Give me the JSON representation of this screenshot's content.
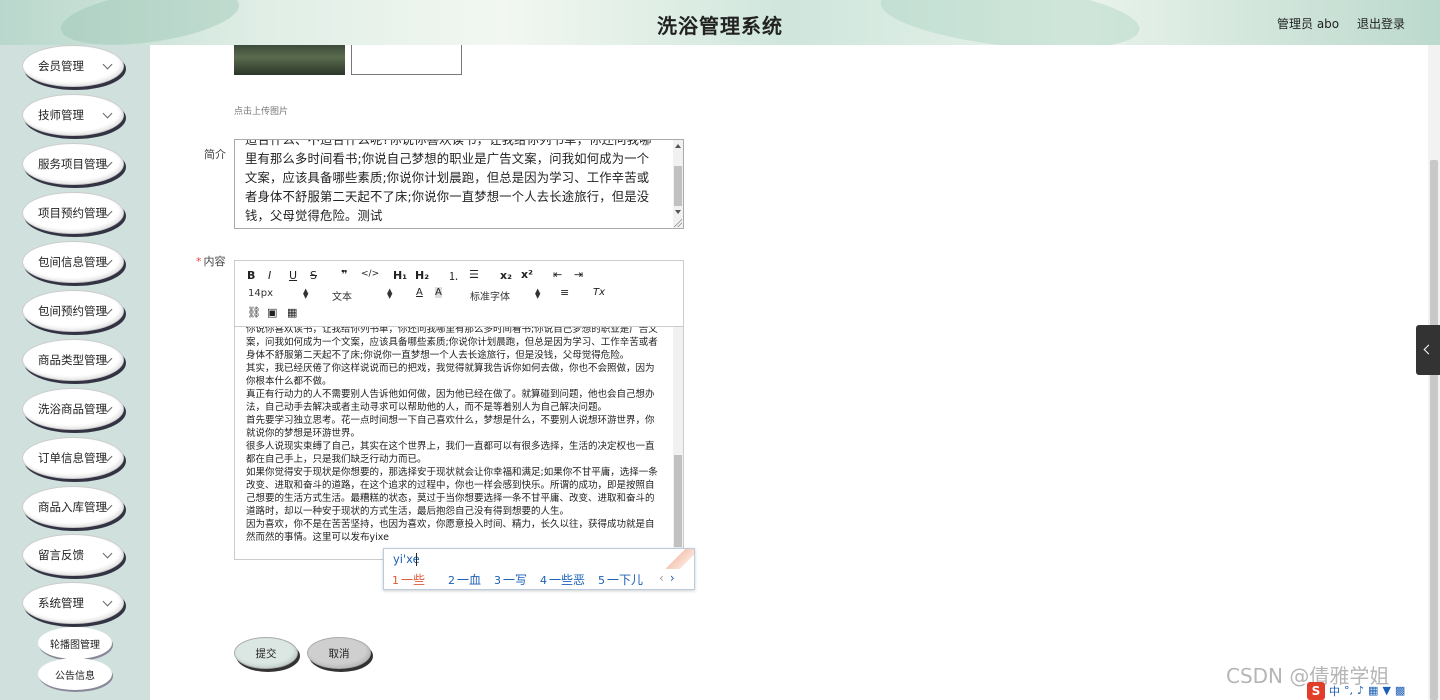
{
  "header": {
    "title": "洗浴管理系统",
    "user": "管理员 abo",
    "logout": "退出登录"
  },
  "sidebar": {
    "items": [
      {
        "label": "会员管理"
      },
      {
        "label": "技师管理"
      },
      {
        "label": "服务项目管理"
      },
      {
        "label": "项目预约管理"
      },
      {
        "label": "包间信息管理"
      },
      {
        "label": "包间预约管理"
      },
      {
        "label": "商品类型管理"
      },
      {
        "label": "洗浴商品管理"
      },
      {
        "label": "订单信息管理"
      },
      {
        "label": "商品入库管理"
      },
      {
        "label": "留言反馈"
      },
      {
        "label": "系统管理"
      }
    ],
    "sub_items": [
      {
        "label": "轮播图管理"
      },
      {
        "label": "公告信息"
      }
    ]
  },
  "form": {
    "upload_hint": "点击上传图片",
    "intro_label": "简介",
    "intro_text": "适合什么、不适合什么呢?你说你喜欢读书，让我给你列书单，你还问我哪里有那么多时间看书;你说自己梦想的职业是广告文案，问我如何成为一个文案，应该具备哪些素质;你说你计划晨跑，但总是因为学习、工作辛苦或者身体不舒服第二天起不了床;你说你一直梦想一个人去长途旅行，但是没钱，父母觉得危险。测试",
    "content_required": "*",
    "content_label": "内容",
    "content_paragraphs": [
      "你说你喜欢读书，让我给你列书单，你还问我哪里有那么多时间看书;你说自己梦想的职业是广告文案，问我如何成为一个文案，应该具备哪些素质;你说你计划晨跑，但总是因为学习、工作辛苦或者身体不舒服第二天起不了床;你说你一直梦想一个人去长途旅行，但是没钱，父母觉得危险。",
      "其实，我已经厌倦了你这样说说而已的把戏，我觉得就算我告诉你如何去做，你也不会照做，因为你根本什么都不做。",
      "真正有行动力的人不需要别人告诉他如何做，因为他已经在做了。就算碰到问题，他也会自己想办法，自己动手去解决或者主动寻求可以帮助他的人，而不是等着别人为自己解决问题。",
      "首先要学习独立思考。花一点时间想一下自己喜欢什么，梦想是什么，不要别人说想环游世界，你就说你的梦想是环游世界。",
      "很多人说现实束缚了自己，其实在这个世界上，我们一直都可以有很多选择，生活的决定权也一直都在自己手上，只是我们缺乏行动力而已。",
      "如果你觉得安于现状是你想要的，那选择安于现状就会让你幸福和满足;如果你不甘平庸，选择一条改变、进取和奋斗的道路，在这个追求的过程中，你也一样会感到快乐。所谓的成功，即是按照自己想要的生活方式生活。最糟糕的状态，莫过于当你想要选择一条不甘平庸、改变、进取和奋斗的道路时，却以一种安于现状的方式生活，最后抱怨自己没有得到想要的人生。",
      "因为喜欢，你不是在苦苦坚持，也因为喜欢，你愿意投入时间、精力，长久以往，获得成功就是自然而然的事情。这里可以发布yixe"
    ],
    "submit": "提交",
    "cancel": "取消"
  },
  "toolbar": {
    "bold": "B",
    "italic": "I",
    "underline": "U",
    "strike": "S",
    "quote": "❞",
    "code": "</>",
    "h1": "H₁",
    "h2": "H₂",
    "ol": "⒈",
    "ul": "☰",
    "sub": "x₂",
    "sup": "x²",
    "outdent": "⇤",
    "indent": "⇥",
    "font_size": "14px",
    "block_type": "文本",
    "color": "A",
    "bg_color": "A",
    "font_family": "标准字体",
    "align": "≡",
    "clean": "Tx",
    "link": "⛓",
    "image": "▣",
    "video": "▦"
  },
  "ime": {
    "pinyin": "yi'xe",
    "candidates": [
      {
        "n": "1",
        "text": "一些"
      },
      {
        "n": "2",
        "text": "一血"
      },
      {
        "n": "3",
        "text": "一写"
      },
      {
        "n": "4",
        "text": "一些恶"
      },
      {
        "n": "5",
        "text": "一下儿"
      }
    ],
    "prev": "‹",
    "next": "›"
  },
  "tray": {
    "s": "S",
    "mode": "中",
    "punct": "°,"
  },
  "watermark": "CSDN @倩雅学姐"
}
